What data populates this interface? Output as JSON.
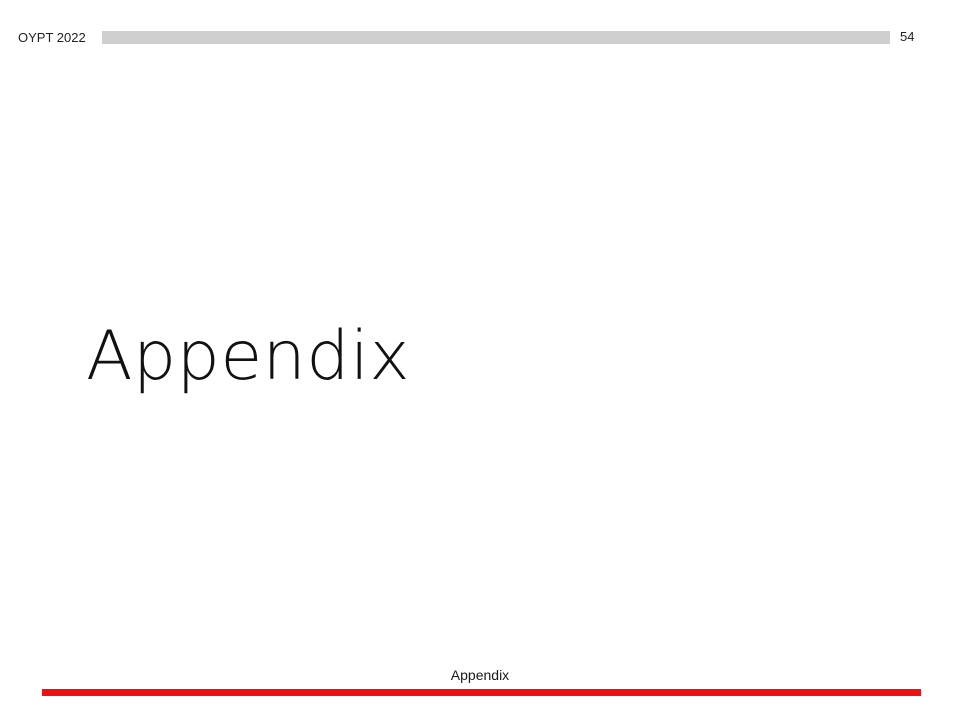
{
  "header": {
    "event": "OYPT 2022",
    "page_number": "54"
  },
  "main": {
    "title": "Appendix"
  },
  "footer": {
    "section_label": "Appendix"
  },
  "colors": {
    "header_bar": "#cfcfcf",
    "footer_bar": "#ee1111",
    "background": "#ffffff"
  }
}
